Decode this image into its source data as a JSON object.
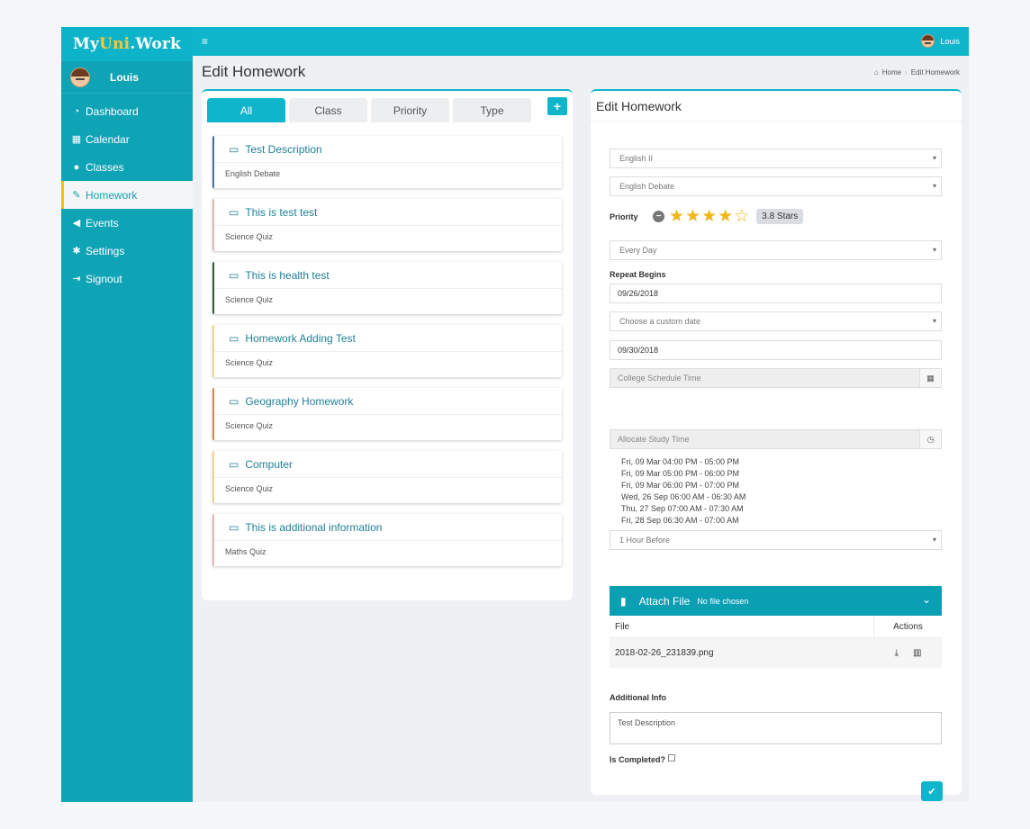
{
  "brand": {
    "logo_my": "My",
    "logo_uni": "Uni",
    "logo_work": ".Work"
  },
  "user": {
    "name": "Louis"
  },
  "sidebar": {
    "items": [
      {
        "label": "Dashboard",
        "icon": "dashboard-icon",
        "glyph": "◔"
      },
      {
        "label": "Calendar",
        "icon": "calendar-icon",
        "glyph": "▦"
      },
      {
        "label": "Classes",
        "icon": "users-icon",
        "glyph": "●"
      },
      {
        "label": "Homework",
        "icon": "edit-icon",
        "glyph": "✎"
      },
      {
        "label": "Events",
        "icon": "bullhorn-icon",
        "glyph": "◀"
      },
      {
        "label": "Settings",
        "icon": "gear-icon",
        "glyph": "✱"
      },
      {
        "label": "Signout",
        "icon": "signout-icon",
        "glyph": "⇥"
      }
    ],
    "active": "Homework"
  },
  "topbar": {
    "menu_glyph": "≡"
  },
  "header": {
    "title": "Edit Homework",
    "breadcrumb": {
      "home": "Home",
      "current": "Edit Homework"
    }
  },
  "left_panel": {
    "tabs": [
      "All",
      "Class",
      "Priority",
      "Type"
    ],
    "active_tab": "All",
    "add_label": "+",
    "homework": [
      {
        "title": "Test Description",
        "subtitle": "English Debate",
        "accent": "#4a6fa8"
      },
      {
        "title": "This is test test",
        "subtitle": "Science Quiz",
        "accent": "#e6b7b7"
      },
      {
        "title": "This is health test",
        "subtitle": "Science Quiz",
        "accent": "#2f5a3c"
      },
      {
        "title": "Homework Adding Test",
        "subtitle": "Science Quiz",
        "accent": "#efd58a"
      },
      {
        "title": "Geography Homework",
        "subtitle": "Science Quiz",
        "accent": "#d9884f"
      },
      {
        "title": "Computer",
        "subtitle": "Science Quiz",
        "accent": "#efd58a"
      },
      {
        "title": "This is additional information",
        "subtitle": "Maths Quiz",
        "accent": "#e6b7b7"
      }
    ]
  },
  "edit_form": {
    "title": "Edit Homework",
    "class_select": "English II",
    "type_select": "English Debate",
    "priority_label": "Priority",
    "priority_stars": 3.8,
    "priority_badge": "3.8 Stars",
    "repeat_select": "Every Day",
    "repeat_begins_label": "Repeat Begins",
    "repeat_begins_value": "09/26/2018",
    "custom_date_placeholder": "Choose a custom date",
    "end_date_value": "09/30/2018",
    "schedule_placeholder": "College Schedule Time",
    "study_time_placeholder": "Allocate Study Time",
    "study_times": [
      "Fri, 09 Mar 04:00 PM - 05:00 PM",
      "Fri, 09 Mar 05:00 PM - 06:00 PM",
      "Fri, 09 Mar 06:00 PM - 07:00 PM",
      "Wed, 26 Sep 06:00 AM - 06:30 AM",
      "Thu, 27 Sep 07:00 AM - 07:30 AM",
      "Fri, 28 Sep 06:30 AM - 07:00 AM"
    ],
    "reminder_select": "1 Hour Before",
    "attach_title": "Attach File",
    "attach_status": "No file chosen",
    "file_table": {
      "headers": [
        "File",
        "Actions"
      ],
      "rows": [
        {
          "file": "2018-02-26_231839.png"
        }
      ]
    },
    "additional_info_label": "Additional Info",
    "additional_info_value": "Test Description",
    "completed_label": "Is Completed?",
    "completed": false
  },
  "colors": {
    "accent": "#0fb5cb",
    "sidebar": "#0fa3b6",
    "star": "#f1b514"
  }
}
